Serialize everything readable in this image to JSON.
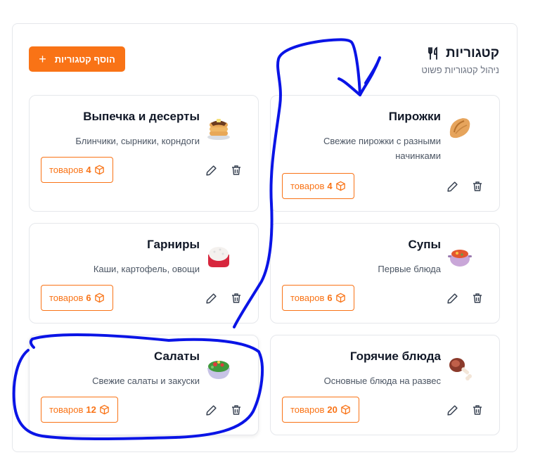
{
  "header": {
    "title": "קטגוריות",
    "subtitle": "ניהול קטגוריות פשוט",
    "icon": "utensils-icon",
    "add_button_label": "הוסף קטגוריות"
  },
  "accent_color": "#f97316",
  "annotation_color": "#0a14e6",
  "categories": [
    {
      "title": "Пирожки",
      "desc": "Свежие пирожки с разными начинками",
      "count_prefix": "товаров",
      "count": "4",
      "emoji": "pirozhok"
    },
    {
      "title": "Выпечка и десерты",
      "desc": "Блинчики, сырники, корндоги",
      "count_prefix": "товаров",
      "count": "4",
      "emoji": "pancakes"
    },
    {
      "title": "Супы",
      "desc": "Первые блюда",
      "count_prefix": "товаров",
      "count": "6",
      "emoji": "soup-pot"
    },
    {
      "title": "Гарниры",
      "desc": "Каши, картофель, овощи",
      "count_prefix": "товаров",
      "count": "6",
      "emoji": "rice-bowl"
    },
    {
      "title": "Горячие блюда",
      "desc": "Основные блюда на развес",
      "count_prefix": "товаров",
      "count": "20",
      "emoji": "meat-on-bone"
    },
    {
      "title": "Салаты",
      "desc": "Свежие салаты и закуски",
      "count_prefix": "товаров",
      "count": "12",
      "emoji": "salad-bowl"
    }
  ]
}
